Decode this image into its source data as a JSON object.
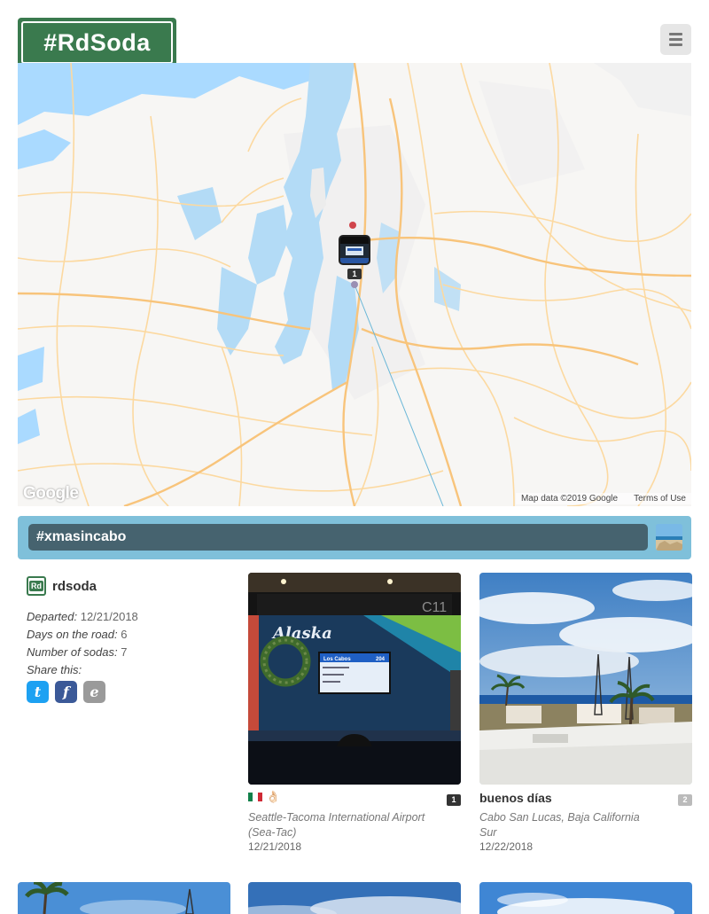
{
  "header": {
    "logo_text": "#RdSoda",
    "menu_icon": "hamburger-menu-icon"
  },
  "map": {
    "google_logo": "Google",
    "attribution": "Map data ©2019 Google",
    "terms": "Terms of Use",
    "marker_count": "1"
  },
  "trip": {
    "hashtag": "#xmasincabo"
  },
  "user": {
    "avatar_text": "Rd",
    "name": "rdsoda"
  },
  "info": {
    "departed_label": "Departed:",
    "departed_value": "12/21/2018",
    "days_label": "Days on the road:",
    "days_value": "6",
    "sodas_label": "Number of sodas:",
    "sodas_value": "7",
    "share_label": "Share this:"
  },
  "share": {
    "twitter": "t",
    "facebook": "f",
    "email": "e"
  },
  "cards": [
    {
      "caption": "",
      "emoji": "👌🏻",
      "badge": "1",
      "badge_color": "#333333",
      "location": "Seattle-Tacoma International Airport (Sea-Tac)",
      "date": "12/21/2018",
      "photo_gate_label": "C11",
      "photo_brand": "Alaska",
      "photo_screen_title": "Los Cabos",
      "photo_screen_num": "204"
    },
    {
      "caption": "buenos días",
      "badge": "2",
      "badge_color": "#bbbbbb",
      "location": "Cabo San Lucas, Baja California Sur",
      "date": "12/22/2018"
    }
  ],
  "colors": {
    "brand_green": "#3a7a4e",
    "trip_bar": "#7fc0da",
    "trip_tag": "#46636f"
  }
}
